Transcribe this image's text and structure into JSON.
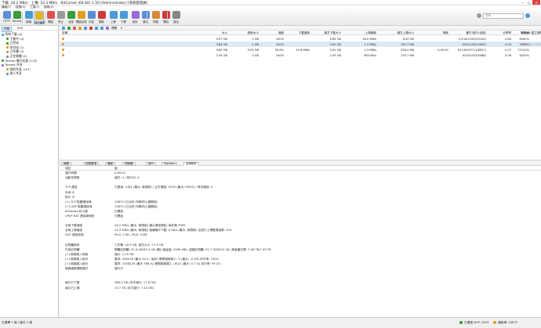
{
  "window": {
    "title": "下載: 26.2 MB/s - 上傳: 22.3 MB/s - BitComet (64-bit) 1.50 [Administrator] [系統管理員]",
    "controls": [
      "─",
      "□",
      "✕"
    ]
  },
  "menu": [
    "檔案(F)",
    "檢視(V)",
    "工具(T)",
    "說明(H)"
  ],
  "toolbar": {
    "items": [
      {
        "label": "HTTP",
        "color": "#5a8fd6"
      },
      {
        "label": "Torrent",
        "color": "#3a9c3a"
      },
      {
        "label": "新增",
        "color": "#4a9ad8"
      },
      {
        "label": "我的最愛",
        "color": "#e6b422"
      },
      {
        "label": "開始",
        "color": "#e05050"
      },
      {
        "label": "停止",
        "color": "#999999"
      },
      {
        "label": "全部",
        "color": "#3a9c3a"
      },
      {
        "label": "開啟目錄",
        "color": "#e0a020"
      },
      {
        "label": "內容",
        "color": "#5a8fd6"
      },
      {
        "label": "刪除",
        "color": "#d03a3a"
      },
      {
        "label": "上移",
        "color": "#4a9ad8"
      },
      {
        "label": "下移",
        "color": "#4a9ad8"
      },
      {
        "label": "統計",
        "color": "#9a6ad8"
      },
      {
        "label": "選項",
        "color": "#5a8fd6"
      },
      {
        "label": "排程",
        "color": "#d88a3a"
      },
      {
        "label": "關機",
        "color": "#d03a3a"
      },
      {
        "label": "退出",
        "color": "#888888"
      }
    ],
    "search_placeholder": "搜尋",
    "search_value": "",
    "search_icon_name": "search-icon"
  },
  "sidebar": {
    "tabs": [
      "任務",
      "RSS"
    ],
    "items": [
      {
        "label": "所有下載 (4)",
        "indent": 0,
        "color": "#4a9ad8"
      },
      {
        "label": "下載中 (4)",
        "indent": 1,
        "color": "#3a9c3a"
      },
      {
        "label": "已完成",
        "indent": 1,
        "color": "#3a9c3a"
      },
      {
        "label": "未完成 (1)",
        "indent": 1,
        "color": "#e0a020"
      },
      {
        "label": "已作種 (3)",
        "indent": 1,
        "color": "#d88a3a"
      },
      {
        "label": "正在做種 (4)",
        "indent": 1,
        "color": "#5a8fd6"
      },
      {
        "label": "Torrent 種子紀錄 (115)",
        "indent": 0,
        "color": "#3a9c3a"
      },
      {
        "label": "Torrent 共享",
        "indent": 0,
        "color": "#9a6ad8"
      },
      {
        "label": "我的共享 (107)",
        "indent": 1,
        "color": "#e0a020"
      },
      {
        "label": "他人共享",
        "indent": 1,
        "color": "#4a9ad8"
      }
    ]
  },
  "main_toolbar": {
    "filter_label": "標籤",
    "filter_value": "▾"
  },
  "list": {
    "columns": [
      "名稱",
      "大小",
      "剩餘大小",
      "進度",
      "下載速度",
      "總共下載大小",
      "上傳速度",
      "總共上傳大小",
      "剩餘",
      "種子/用戶(全部)",
      "分享率",
      "健康度",
      "Torrent 建立時間"
    ],
    "rows": [
      {
        "size": "9.57 GB",
        "remaining": "0 GB",
        "progress": "100%",
        "down": "",
        "total_down": "9.65 GB",
        "up": "18.0 MB/s",
        "total_up": "8.20 GB",
        "eta": "",
        "seeds": "0/154(1345/29100)",
        "ratio": "0.84",
        "health": "8445%",
        "created": ""
      },
      {
        "size": "3.84 GB",
        "remaining": "0 GB",
        "progress": "100%",
        "down": "",
        "total_down": "3.90 GB",
        "up": "1.2 MB/s",
        "total_up": "150.7 MB",
        "eta": "",
        "seeds": "0/55(126/14902)",
        "ratio": "0.04",
        "health": "2298%",
        "created": "2019-09-15 09:27:01"
      },
      {
        "size": "9.80 GB",
        "remaining": "9.03 GB",
        "progress": "35.8%",
        "down": "24.8 MB/s",
        "total_down": "4.00 GB",
        "up": "2.3 MB/s",
        "total_up": "308.4 MB",
        "eta": "0:05:42",
        "seeds": "671/62(971/1/6837)",
        "ratio": "0.07",
        "health": "77510%",
        "created": ""
      },
      {
        "size": "2.49 GB",
        "remaining": "0 GB",
        "progress": "100%",
        "down": "",
        "total_down": "2.49 GB",
        "up": "963 KB/s",
        "total_up": "155.7 MB",
        "eta": "",
        "seeds": "0/102(533/5388)",
        "ratio": "0.06",
        "health": "6259%",
        "created": ""
      }
    ]
  },
  "detail_tabs": [
    "摘要",
    "任務選項",
    "檔案",
    "伺服器",
    "用戶",
    "Trackers",
    "全局統計"
  ],
  "detail": {
    "rows": [
      {
        "label": "項目",
        "value": "值"
      },
      {
        "label": "運行時間",
        "value": "0:09:01"
      },
      {
        "label": "活動任務數",
        "value": "總共: 4 / 執行中: 4"
      },
      {
        "label": "",
        "value": ""
      },
      {
        "label": "TCP 連接",
        "value": "已連接: 1482 (最大: 無限制) / 正在連接: 9318 (最大:10000) / 等待連接: 0"
      },
      {
        "label": "本地 IP",
        "value": ""
      },
      {
        "label": "對外 IP",
        "value": ""
      },
      {
        "label": "[+] TCP 監聽連接埠",
        "value": "10875 (已允許-外網/防火牆開啟)"
      },
      {
        "label": "[+] UDP 監聽連接埠",
        "value": "10875 (已允許-外網/防火牆開啟)"
      },
      {
        "label": "Windows 防火牆",
        "value": "已開啟"
      },
      {
        "label": "UPnP NAT 連接埠映射",
        "value": "已開啟"
      },
      {
        "label": "",
        "value": ""
      },
      {
        "label": "全局下載速度",
        "value": "26.2 MB/s (最大: 無限制)    最大連接限制: 每任務 9999"
      },
      {
        "label": "全局上傳速度",
        "value": "22.3 MB/s (最大: 無限制)    做種種子下載: 0 KB/s (最大: 無限制)    全部打上標籤連接數: 344"
      },
      {
        "label": "DHT 連接狀態",
        "value": "IPv4: 1781, IPv6: 1438"
      },
      {
        "label": "",
        "value": ""
      },
      {
        "label": "記憶體使用",
        "value": "工作集: 16.9 GB, 提交大小: 17.9 GB"
      },
      {
        "label": "可用記憶體",
        "value": "實體記憶體: 31.8 GB/63.9 GB (最小保留量: 4096 MB), 虛擬記憶體: 52.7 GB/83.0 GB, 頁面檔空間: 7.98 TB/7.99 TB"
      },
      {
        "label": "[+] 磁碟寫入快取",
        "value": "總共: 1.25 GB"
      },
      {
        "label": "[+] 磁碟寫入統計",
        "value": "要求: 43601B (最大 54.0 / 每秒) 實際磁碟寫入: 0 (最大: -0 GB) 命中率: 100%"
      },
      {
        "label": "[+] 磁碟讀入統計",
        "value": "要求: 1058226 (最大 368 /s) 實際磁碟讀入: 3822 (最大: 0.7 /s) 命中率: 99.4%"
      },
      {
        "label": "磁碟緩衝選取模式",
        "value": "運行中"
      },
      {
        "label": "",
        "value": ""
      },
      {
        "label": "",
        "value": ""
      },
      {
        "label": "總共已下載",
        "value": "486.0 GB (本次運行: 17.6 GB)"
      },
      {
        "label": "總共已上傳",
        "value": "13.7 TB (本次運行: 7.10 GB)"
      }
    ]
  },
  "status": {
    "left": "已選擇 1 項 / 總共 4 項",
    "dht": "已連接 DHT: 3219",
    "port": "連接埠: 10875"
  }
}
